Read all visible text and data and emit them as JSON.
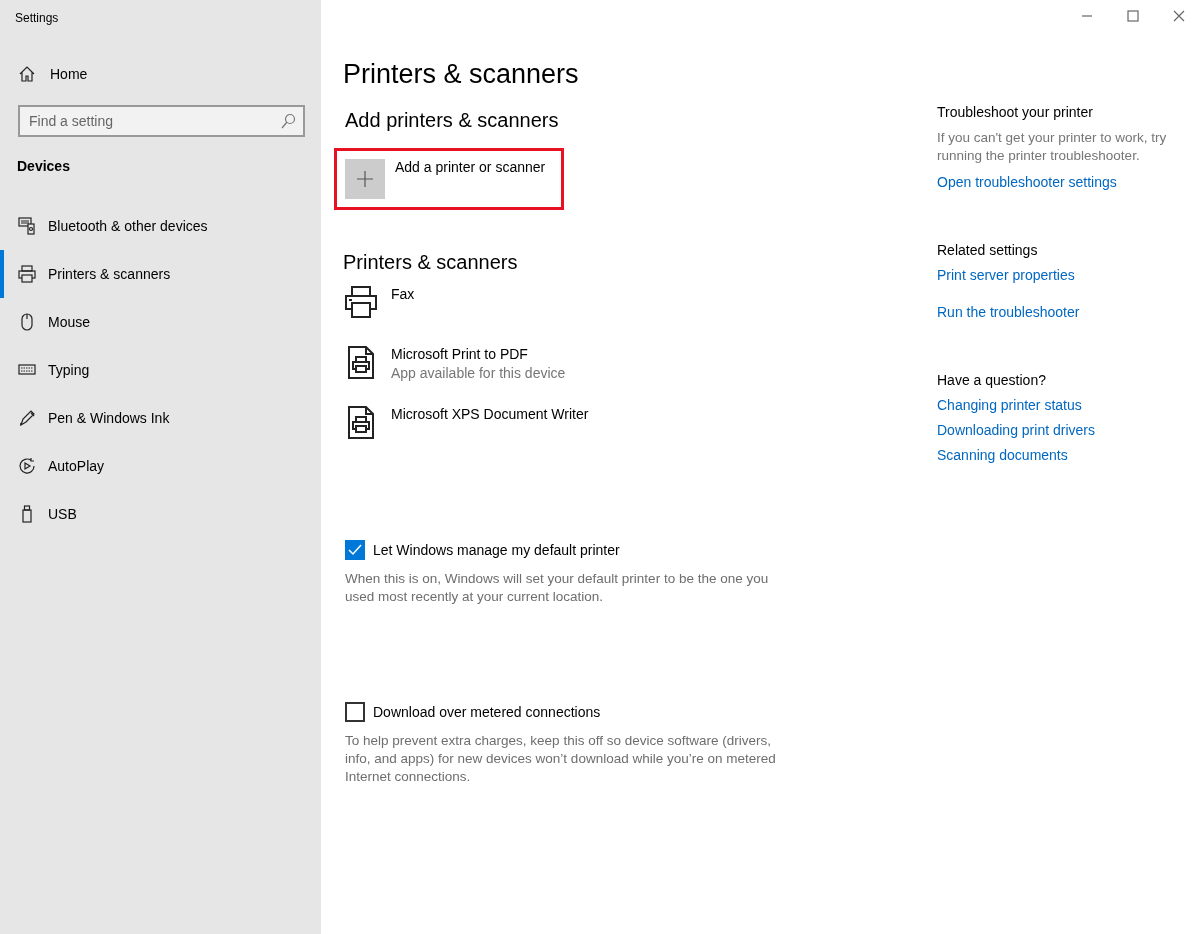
{
  "window": {
    "title": "Settings"
  },
  "sidebar": {
    "home": "Home",
    "search": {
      "placeholder": "Find a setting"
    },
    "section": "Devices",
    "items": [
      {
        "label": "Bluetooth & other devices",
        "selected": false
      },
      {
        "label": "Printers & scanners",
        "selected": true
      },
      {
        "label": "Mouse",
        "selected": false
      },
      {
        "label": "Typing",
        "selected": false
      },
      {
        "label": "Pen & Windows Ink",
        "selected": false
      },
      {
        "label": "AutoPlay",
        "selected": false
      },
      {
        "label": "USB",
        "selected": false
      }
    ]
  },
  "main": {
    "title": "Printers & scanners",
    "add_section": {
      "heading": "Add printers & scanners",
      "button": {
        "label": "Add a printer or scanner",
        "highlighted": true
      }
    },
    "devices_section": {
      "heading": "Printers & scanners",
      "devices": [
        {
          "name": "Fax"
        },
        {
          "name": "Microsoft Print to PDF",
          "status": "App available for this device"
        },
        {
          "name": "Microsoft XPS Document Writer"
        }
      ]
    },
    "options": [
      {
        "label": "Let Windows manage my default printer",
        "checked": true,
        "description": "When this is on, Windows will set your default printer to be the one you used most recently at your current location."
      },
      {
        "label": "Download over metered connections",
        "checked": false,
        "description": "To help prevent extra charges, keep this off so device software (drivers, info, and apps) for new devices won’t download while you’re on metered Internet connections."
      }
    ]
  },
  "side_panel": [
    {
      "heading": "Troubleshoot your printer",
      "description": "If you can't get your printer to work, try running the printer troubleshooter.",
      "links": [
        "Open troubleshooter settings"
      ]
    },
    {
      "heading": "Related settings",
      "links": [
        "Print server properties",
        "Run the troubleshooter"
      ]
    },
    {
      "heading": "Have a question?",
      "links": [
        "Changing printer status",
        "Downloading print drivers",
        "Scanning documents"
      ]
    }
  ]
}
